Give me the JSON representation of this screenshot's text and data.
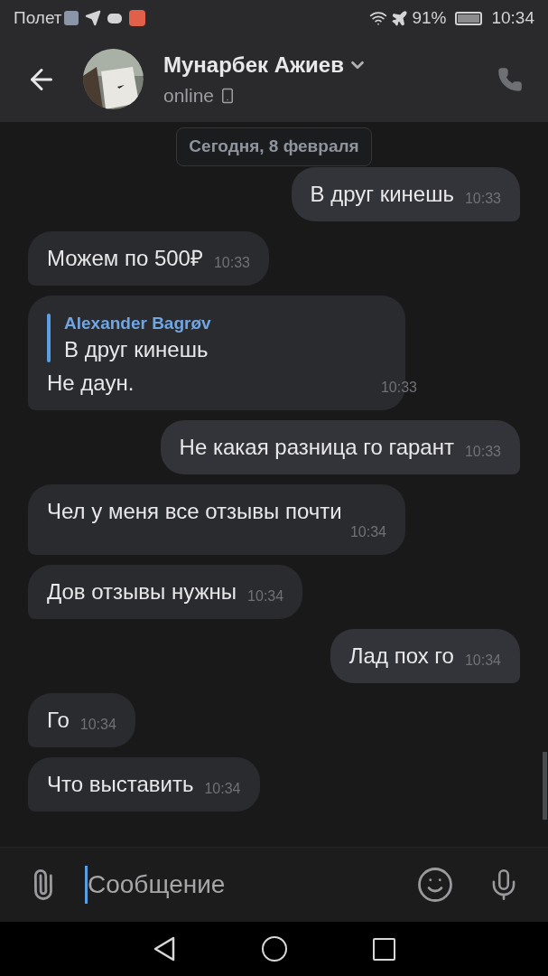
{
  "status_bar": {
    "carrier": "Полет",
    "battery": "91%",
    "time": "10:34"
  },
  "header": {
    "name": "Мунарбек Ажиев",
    "status": "online"
  },
  "date_chip": "Сегодня, 8 февраля",
  "messages": [
    {
      "kind": "text",
      "outgoing": true,
      "text": "В друг кинешь",
      "time": "10:33"
    },
    {
      "kind": "text",
      "outgoing": false,
      "text": "Можем по 500₽",
      "time": "10:33"
    },
    {
      "kind": "quote",
      "outgoing": false,
      "quote_author": "Alexander Bagrøv",
      "quote_text": "В друг кинешь",
      "text": "Не даун.",
      "time": "10:33"
    },
    {
      "kind": "text",
      "outgoing": true,
      "text": "Не какая разница го гарант",
      "time": "10:33"
    },
    {
      "kind": "text",
      "outgoing": false,
      "text": "Чел у меня все отзывы почти",
      "time": "10:34"
    },
    {
      "kind": "text",
      "outgoing": false,
      "text": "Дов отзывы нужны",
      "time": "10:34"
    },
    {
      "kind": "text",
      "outgoing": true,
      "text": "Лад пох го",
      "time": "10:34"
    },
    {
      "kind": "text",
      "outgoing": false,
      "text": "Го",
      "time": "10:34"
    },
    {
      "kind": "text",
      "outgoing": false,
      "text": "Что выставить",
      "time": "10:34"
    }
  ],
  "composer": {
    "placeholder": "Сообщение"
  }
}
